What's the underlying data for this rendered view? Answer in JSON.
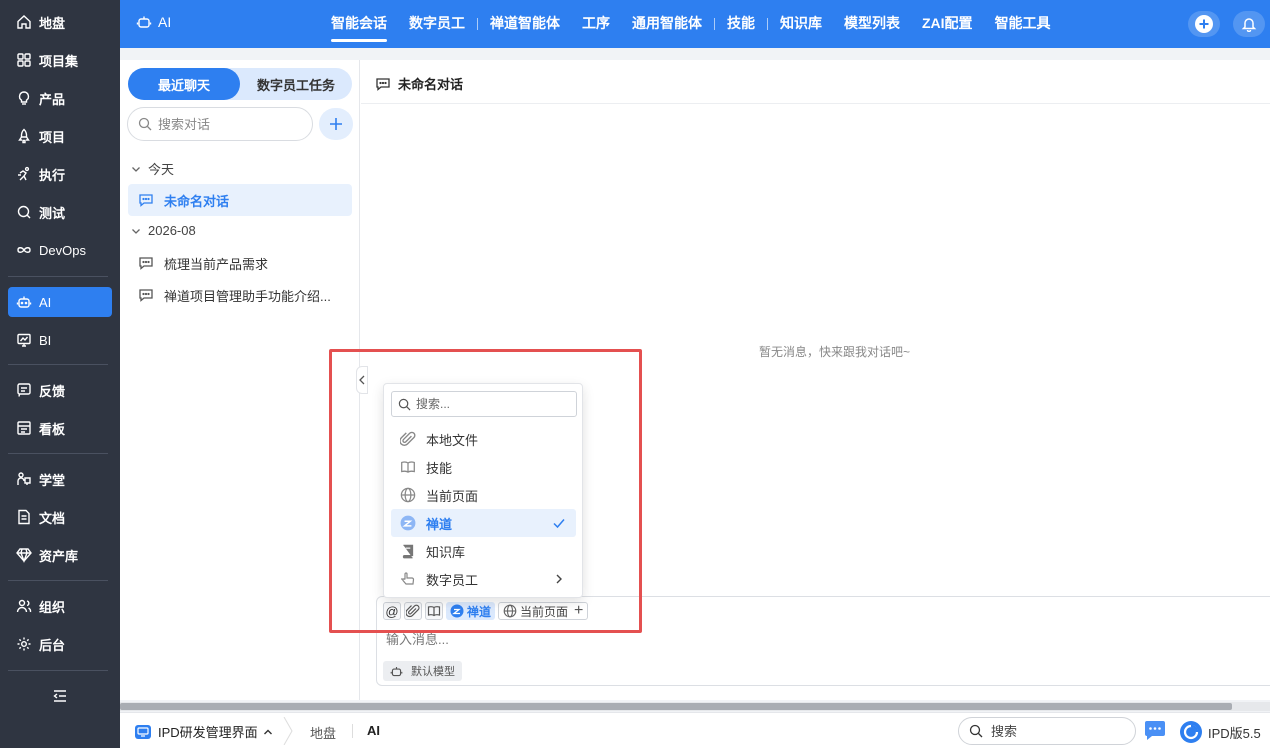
{
  "sidebar": {
    "items": [
      {
        "label": "地盘",
        "icon": "home-icon"
      },
      {
        "label": "项目集",
        "icon": "grid-icon"
      },
      {
        "label": "产品",
        "icon": "bulb-icon"
      },
      {
        "label": "项目",
        "icon": "rocket-icon"
      },
      {
        "label": "执行",
        "icon": "run-icon"
      },
      {
        "label": "测试",
        "icon": "magnifier-icon"
      },
      {
        "label": "DevOps",
        "icon": "infinity-icon"
      },
      {
        "label": "AI",
        "icon": "robot-icon"
      },
      {
        "label": "BI",
        "icon": "chart-board-icon"
      },
      {
        "label": "反馈",
        "icon": "feedback-icon"
      },
      {
        "label": "看板",
        "icon": "kanban-icon"
      },
      {
        "label": "学堂",
        "icon": "school-icon"
      },
      {
        "label": "文档",
        "icon": "document-icon"
      },
      {
        "label": "资产库",
        "icon": "diamond-icon"
      },
      {
        "label": "组织",
        "icon": "people-icon"
      },
      {
        "label": "后台",
        "icon": "gear-icon"
      }
    ],
    "active": "AI"
  },
  "topbar": {
    "app_label": "AI",
    "tabs": [
      "智能会话",
      "数字员工",
      "禅道智能体",
      "工序",
      "通用智能体",
      "技能",
      "知识库",
      "模型列表",
      "ZAI配置",
      "智能工具"
    ],
    "active_tab": "智能会话"
  },
  "left_panel": {
    "segments": [
      "最近聊天",
      "数字员工任务"
    ],
    "active_segment": "最近聊天",
    "search_placeholder": "搜索对话",
    "groups": [
      {
        "label": "今天",
        "conversations": [
          "未命名对话"
        ]
      },
      {
        "label": "2026-08",
        "conversations": [
          "梳理当前产品需求",
          "禅道项目管理助手功能介绍..."
        ]
      }
    ],
    "active_conversation": "未命名对话"
  },
  "right_panel": {
    "title": "未命名对话",
    "empty_message": "暂无消息，快来跟我对话吧~"
  },
  "dropdown": {
    "search_placeholder": "搜索...",
    "items": [
      {
        "label": "本地文件",
        "icon": "paperclip-icon"
      },
      {
        "label": "技能",
        "icon": "book-open-icon"
      },
      {
        "label": "当前页面",
        "icon": "globe-icon"
      },
      {
        "label": "禅道",
        "icon": "zentao-logo-icon",
        "selected": true
      },
      {
        "label": "知识库",
        "icon": "book-icon"
      },
      {
        "label": "数字员工",
        "icon": "hand-pointer-icon",
        "has_submenu": true
      }
    ]
  },
  "composer": {
    "at_symbol": "@",
    "chip_zentao": "禅道",
    "chip_current_page": "当前页面",
    "input_placeholder": "输入消息...",
    "model_label": "默认模型"
  },
  "bottombar": {
    "project": "IPD研发管理界面",
    "breadcrumbs": [
      "地盘",
      "AI"
    ],
    "search_placeholder": "搜索",
    "version": "IPD版5.5"
  },
  "colors": {
    "accent": "#2e7ff0",
    "sidebar_bg": "#2f3541",
    "highlight_border": "#e45050"
  }
}
